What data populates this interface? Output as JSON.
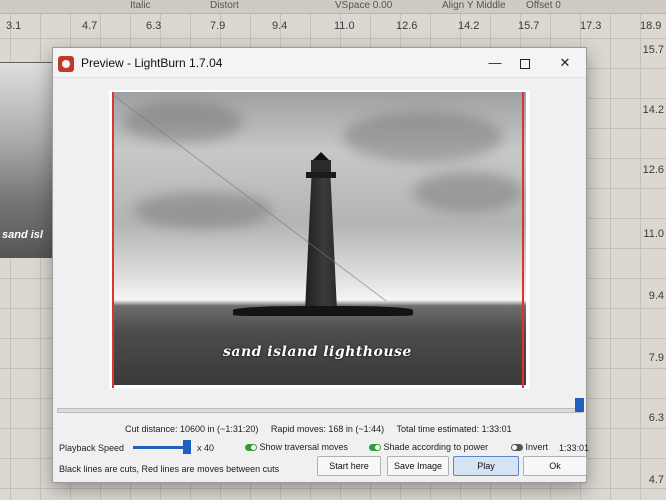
{
  "background": {
    "toolbar": {
      "italic_label": "Italic",
      "distort_label": "Distort",
      "vspace": "VSpace 0.00",
      "align": "Align Y Middle",
      "offset": "Offset 0"
    },
    "ruler_top": [
      "3.1",
      "4.7",
      "6.3",
      "7.9",
      "9.4",
      "11.0",
      "12.6",
      "14.2",
      "15.7",
      "17.3",
      "18.9"
    ],
    "ruler_right": [
      "15.7",
      "14.2",
      "12.6",
      "11.0",
      "9.4",
      "7.9",
      "6.3",
      "4.7"
    ],
    "thumb_text": "sand isl"
  },
  "window": {
    "title": "Preview - LightBurn 1.7.04",
    "min_glyph": "—",
    "close_glyph": "✕"
  },
  "preview": {
    "caption": "sand island lighthouse"
  },
  "progress": {
    "value": 1.0
  },
  "stats": {
    "cut_distance": "Cut distance: 10600 in (~1:31:20)",
    "rapid_moves": "Rapid moves: 168 in (~1:44)",
    "total_time": "Total time estimated: 1:33:01"
  },
  "controls": {
    "playback_speed_label": "Playback Speed",
    "speed_value": "x 40",
    "show_traversal_label": "Show traversal moves",
    "show_traversal_on": true,
    "shade_label": "Shade according to power",
    "shade_on": true,
    "invert_label": "Invert",
    "invert_on": false,
    "time_value": "1:33:01"
  },
  "hint": "Black lines are cuts, Red lines are moves between cuts",
  "buttons": {
    "start_here": "Start here",
    "save_image": "Save Image",
    "play": "Play",
    "ok": "Ok"
  },
  "colors": {
    "accent": "#1f5fbf",
    "cut_line": "#d33333",
    "toggle_on": "#2e9e3a"
  }
}
